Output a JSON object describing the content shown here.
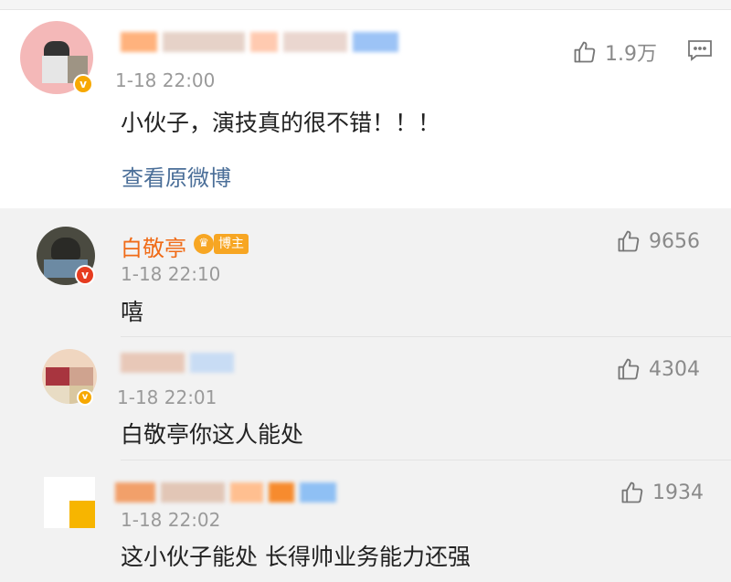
{
  "main_comment": {
    "time": "1-18 22:00",
    "text": "小伙子，演技真的很不错！！！",
    "likes": "1.9万",
    "view_original": "查看原微博"
  },
  "replies": [
    {
      "author": "白敬亭",
      "badge": "博主",
      "time": "1-18 22:10",
      "text": "嘻",
      "likes": "9656"
    },
    {
      "time": "1-18 22:01",
      "text": "白敬亭你这人能处",
      "likes": "4304"
    },
    {
      "time": "1-18 22:02",
      "text": "这小伙子能处 长得帅业务能力还强",
      "likes": "1934"
    }
  ],
  "icons": {
    "like": "thumbs-up-icon",
    "share": "share-icon",
    "verified": "verified-v-icon"
  },
  "colors": {
    "link": "#4a6e98",
    "author_highlight": "#f06b17",
    "badge": "#f7a623"
  }
}
